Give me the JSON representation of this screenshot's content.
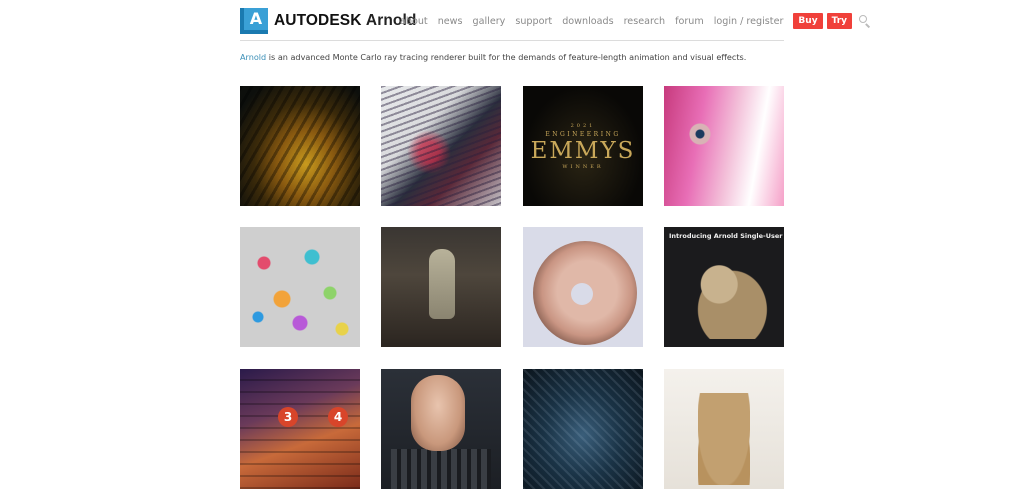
{
  "header": {
    "logo": {
      "mark": "A",
      "brand": "AUTODESK",
      "product": "Arnold",
      "colors": {
        "light": "#3aa0d6",
        "dark": "#1a7ab0"
      }
    },
    "nav": [
      "about",
      "news",
      "gallery",
      "support",
      "downloads",
      "research",
      "forum",
      "login / register"
    ],
    "buttons": {
      "buy": "Buy",
      "try": "Try"
    },
    "accent": "#f0403a",
    "search_icon": "search-icon"
  },
  "intro": {
    "lead": "Arnold",
    "text": " is an advanced Monte Carlo ray tracing renderer built for the demands of feature-length animation and visual effects."
  },
  "gallery": {
    "emmys": {
      "year": "2021",
      "line1": "ENGINEERING",
      "title": "EMMYS",
      "line2": "WINNER"
    },
    "single_user_caption": "Introducing Arnold Single-User",
    "platform_numbers": [
      "3",
      "4"
    ]
  }
}
